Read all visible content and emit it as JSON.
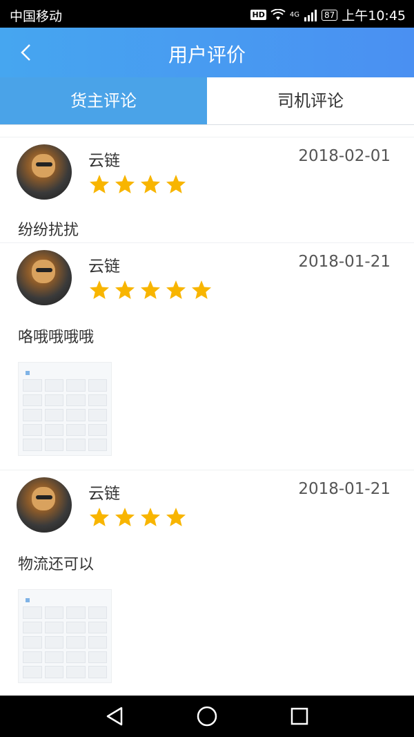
{
  "status_bar": {
    "carrier": "中国移动",
    "hd": "HD",
    "network": "4G",
    "battery": "87",
    "time": "上午10:45"
  },
  "header": {
    "title": "用户评价",
    "back_icon": "chevron-left-icon"
  },
  "tabs": [
    {
      "label": "货主评论",
      "active": true
    },
    {
      "label": "司机评论",
      "active": false
    }
  ],
  "reviews": [
    {
      "name": "云链",
      "date": "2018-02-01",
      "rating": 4,
      "comment": "纷纷扰扰",
      "has_image": false
    },
    {
      "name": "云链",
      "date": "2018-01-21",
      "rating": 5,
      "comment": "咯哦哦哦哦",
      "has_image": true
    },
    {
      "name": "云链",
      "date": "2018-01-21",
      "rating": 4,
      "comment": "物流还可以",
      "has_image": true
    }
  ],
  "colors": {
    "header_start": "#46a6f0",
    "header_end": "#4a90f2",
    "tab_active": "#4aa3e8",
    "star": "#f8b500"
  },
  "nav": {
    "back": "triangle-back-icon",
    "home": "circle-home-icon",
    "recent": "square-recent-icon"
  }
}
